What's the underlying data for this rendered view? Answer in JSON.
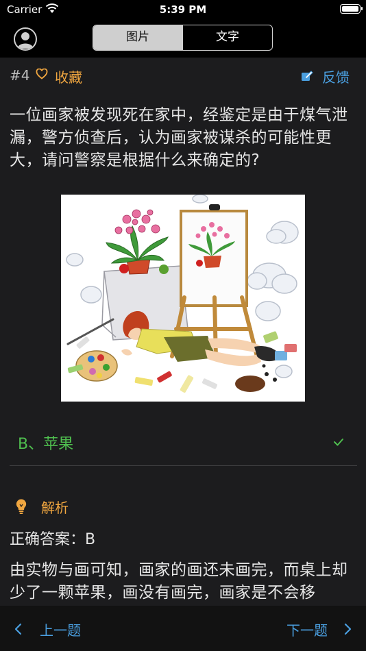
{
  "status_bar": {
    "carrier": "Carrier",
    "time": "5:39 PM"
  },
  "nav": {
    "tabs": [
      {
        "label": "图片",
        "active": true
      },
      {
        "label": "文字",
        "active": false
      }
    ]
  },
  "question_meta": {
    "number": "#4",
    "favorite_label": "收藏",
    "feedback_label": "反馈"
  },
  "question": {
    "text": "一位画家被发现死在家中，经鉴定是由于煤气泄漏，警方侦查后，认为画家被谋杀的可能性更大，请问警察是根据什么来确定的?"
  },
  "answer": {
    "text": "B、苹果",
    "status": "correct"
  },
  "analysis": {
    "label": "解析",
    "correct_answer": "正确答案：B",
    "explanation": "由实物与画可知，画家的画还未画完，而桌上却少了一颗苹果，画没有画完，画家是不会移"
  },
  "bottom_nav": {
    "prev_label": "上一题",
    "next_label": "下一题"
  },
  "colors": {
    "accent_orange": "#f0a640",
    "accent_blue": "#4a9fe0",
    "correct_green": "#4fbf4f"
  },
  "icons": [
    "avatar-icon",
    "heart-icon",
    "edit-icon",
    "check-icon",
    "lightbulb-icon",
    "chevron-left-icon",
    "chevron-right-icon"
  ]
}
